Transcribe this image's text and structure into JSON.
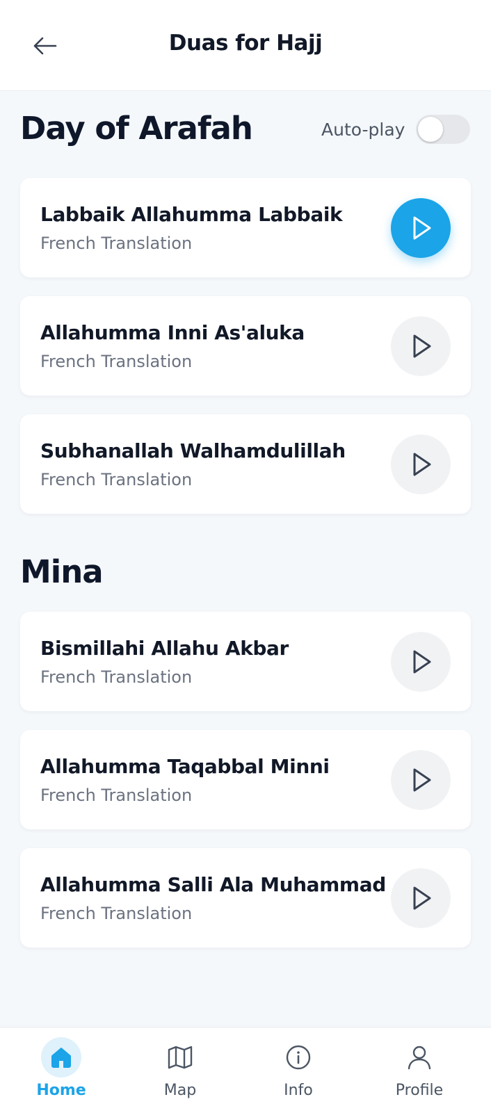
{
  "header": {
    "title": "Duas for Hajj"
  },
  "autoplay": {
    "label": "Auto-play",
    "enabled": false
  },
  "colors": {
    "accent": "#1ba4e8",
    "text": "#111827",
    "muted": "#6b7280",
    "background": "#f5f8fb"
  },
  "sections": [
    {
      "title": "Day of Arafah",
      "items": [
        {
          "title": "Labbaik Allahumma Labbaik",
          "subtitle": "French Translation",
          "playing": true
        },
        {
          "title": "Allahumma Inni As'aluka",
          "subtitle": "French Translation",
          "playing": false
        },
        {
          "title": "Subhanallah Walhamdulillah",
          "subtitle": "French Translation",
          "playing": false
        }
      ]
    },
    {
      "title": "Mina",
      "items": [
        {
          "title": "Bismillahi Allahu Akbar",
          "subtitle": "French Translation",
          "playing": false
        },
        {
          "title": "Allahumma Taqabbal Minni",
          "subtitle": "French Translation",
          "playing": false
        },
        {
          "title": "Allahumma Salli Ala Muhammad",
          "subtitle": "French Translation",
          "playing": false
        }
      ]
    }
  ],
  "nav": [
    {
      "label": "Home",
      "icon": "home-icon",
      "active": true
    },
    {
      "label": "Map",
      "icon": "map-icon",
      "active": false
    },
    {
      "label": "Info",
      "icon": "info-icon",
      "active": false
    },
    {
      "label": "Profile",
      "icon": "user-icon",
      "active": false
    }
  ]
}
